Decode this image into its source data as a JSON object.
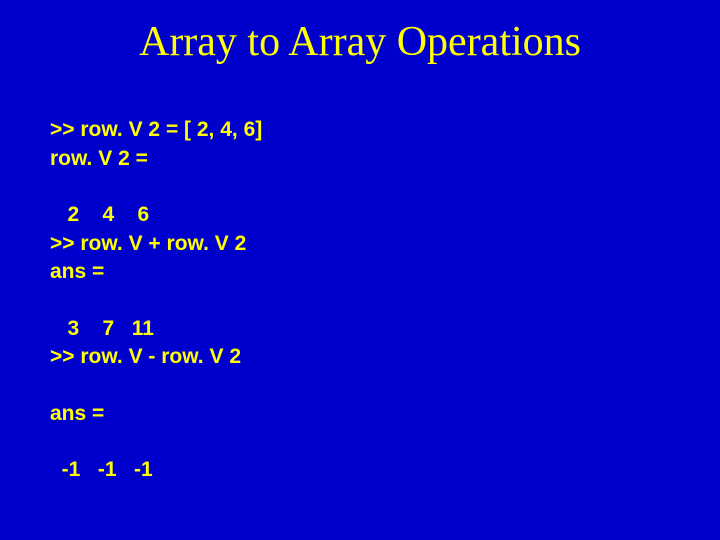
{
  "title": "Array to Array Operations",
  "lines": {
    "l0": ">> row. V 2 = [ 2, 4, 6]",
    "l1": "row. V 2 =",
    "l2": "",
    "l3": "   2    4    6",
    "l4": ">> row. V + row. V 2",
    "l5": "ans =",
    "l6": "",
    "l7": "   3    7   11",
    "l8": ">> row. V - row. V 2",
    "l9": "",
    "l10": "ans =",
    "l11": "",
    "l12": "  -1   -1   -1"
  }
}
